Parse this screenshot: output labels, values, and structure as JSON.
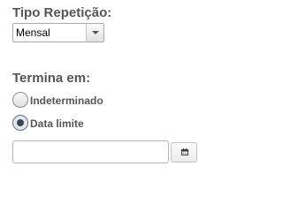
{
  "repeat_type": {
    "label": "Tipo Repetição:",
    "selected": "Mensal"
  },
  "end": {
    "label": "Termina em:",
    "options": [
      {
        "label": "Indeterminado",
        "checked": false
      },
      {
        "label": "Data limite",
        "checked": true
      }
    ],
    "date_value": "",
    "calendar_icon": "calendar-icon"
  }
}
